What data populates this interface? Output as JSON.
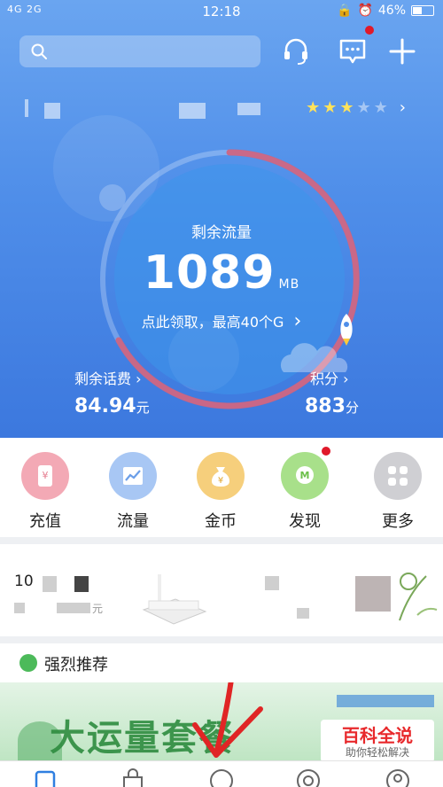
{
  "status_bar": {
    "signal": "4G 2G",
    "time": "12:18",
    "battery": "46%",
    "battery_level": 0.46
  },
  "search": {
    "placeholder": ""
  },
  "hero": {
    "flow_label": "剩余流量",
    "flow_value": "1089",
    "flow_unit": "MB",
    "claim_text": "点此领取，最高40个G",
    "balance_label": "剩余话费",
    "balance_value": "84.94",
    "balance_unit": "元",
    "points_label": "积分",
    "points_value": "883",
    "points_unit": "分",
    "stars_filled": 3,
    "stars_total": 5
  },
  "quick_menu": [
    {
      "label": "充值",
      "icon": "recharge-icon",
      "color": "#f3a9b5"
    },
    {
      "label": "流量",
      "icon": "data-chart-icon",
      "color": "#a8c7f4"
    },
    {
      "label": "金币",
      "icon": "coin-bag-icon",
      "color": "#f6cf7c"
    },
    {
      "label": "发现",
      "icon": "discover-icon",
      "color": "#a8e08a"
    },
    {
      "label": "更多",
      "icon": "more-grid-icon",
      "color": "#cfcfd3"
    }
  ],
  "promo": {
    "number": "10",
    "sub": "元"
  },
  "recommend": {
    "title": "强烈推荐"
  },
  "banner": {
    "text": "大运量套餐"
  },
  "watermark": {
    "main": "百科全说",
    "sub": "助你轻松解决"
  },
  "colors": {
    "accent": "#4f8ee9",
    "ring": "#d2627c",
    "badge": "#e0192a"
  }
}
